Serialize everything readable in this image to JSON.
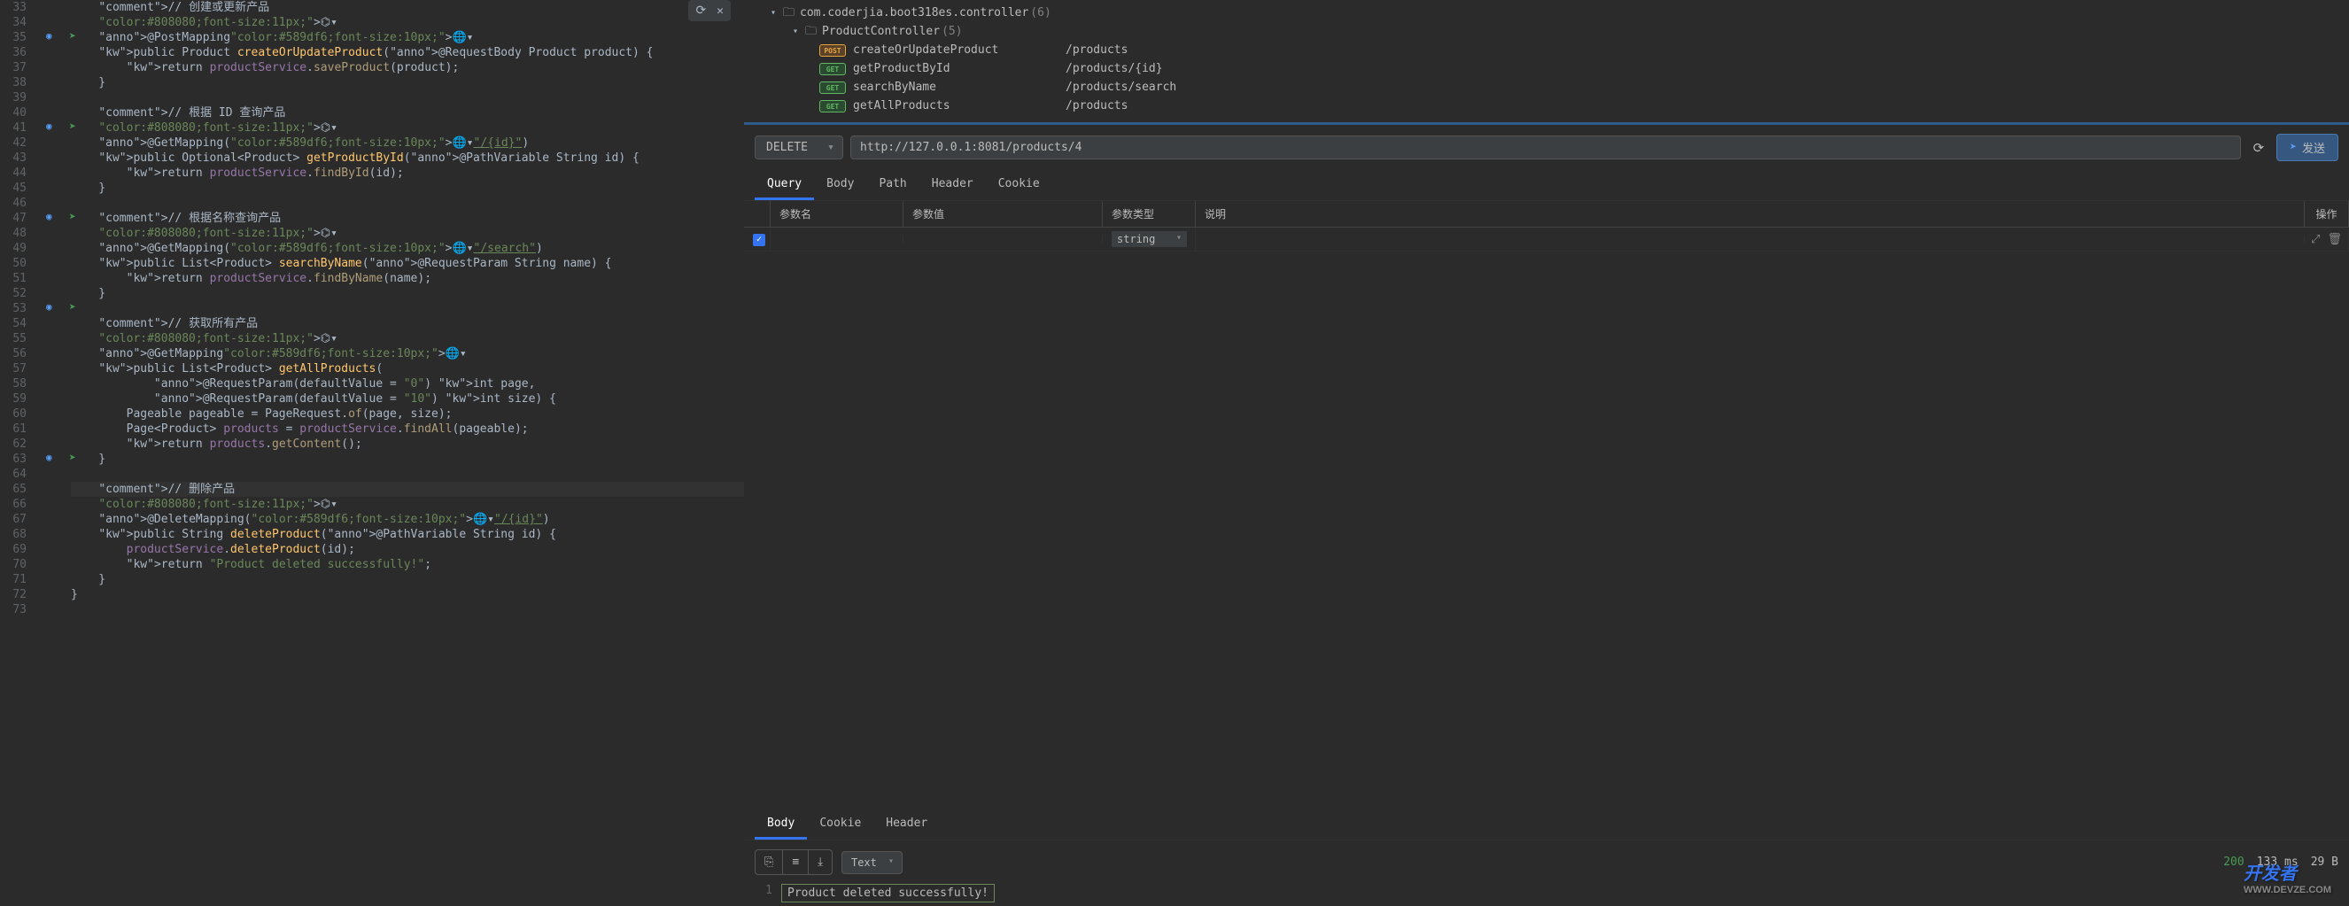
{
  "editor": {
    "firstLine": 33,
    "lines": [
      "    // 创建或更新产品",
      "    ⌬▾",
      "    @PostMapping🌐▾",
      "    public Product createOrUpdateProduct(@RequestBody Product product) {",
      "        return productService.saveProduct(product);",
      "    }",
      "",
      "    // 根据 ID 查询产品",
      "    ⌬▾",
      "    @GetMapping(🌐▾\"/{id}\")",
      "    public Optional<Product> getProductById(@PathVariable String id) {",
      "        return productService.findById(id);",
      "    }",
      "",
      "    // 根据名称查询产品",
      "    ⌬▾",
      "    @GetMapping(🌐▾\"/search\")",
      "    public List<Product> searchByName(@RequestParam String name) {",
      "        return productService.findByName(name);",
      "    }",
      "",
      "    // 获取所有产品",
      "    ⌬▾",
      "    @GetMapping🌐▾",
      "    public List<Product> getAllProducts(",
      "            @RequestParam(defaultValue = \"0\") int page,",
      "            @RequestParam(defaultValue = \"10\") int size) {",
      "        Pageable pageable = PageRequest.of(page, size);",
      "        Page<Product> products = productService.findAll(pageable);",
      "        return products.getContent();",
      "    }",
      "",
      "    // 删除产品",
      "    ⌬▾",
      "    @DeleteMapping(🌐▾\"/{id}\")",
      "    public String deleteProduct(@PathVariable String id) {",
      "        productService.deleteProduct(id);",
      "        return \"Product deleted successfully!\";",
      "    }",
      "}",
      ""
    ]
  },
  "tree": {
    "package": "com.coderjia.boot318es.controller",
    "packageCount": "(6)",
    "controller": "ProductController",
    "controllerCount": "(5)",
    "endpoints": [
      {
        "method": "POST",
        "name": "createOrUpdateProduct",
        "path": "/products"
      },
      {
        "method": "GET",
        "name": "getProductById",
        "path": "/products/{id}"
      },
      {
        "method": "GET",
        "name": "searchByName",
        "path": "/products/search"
      },
      {
        "method": "GET",
        "name": "getAllProducts",
        "path": "/products"
      }
    ]
  },
  "request": {
    "method": "DELETE",
    "url": "http://127.0.0.1:8081/products/4",
    "sendLabel": "发送"
  },
  "requestTabs": [
    "Query",
    "Body",
    "Path",
    "Header",
    "Cookie"
  ],
  "paramsHeader": {
    "name": "参数名",
    "value": "参数值",
    "type": "参数类型",
    "desc": "说明",
    "ops": "操作"
  },
  "paramsRows": [
    {
      "checked": true,
      "name": "",
      "value": "",
      "type": "string",
      "desc": ""
    }
  ],
  "responseTabs": [
    "Body",
    "Cookie",
    "Header"
  ],
  "response": {
    "format": "Text",
    "statusCode": "200",
    "time": "133 ms",
    "size": "29 B",
    "body": "Product deleted successfully!"
  },
  "watermark": {
    "main": "开发者",
    "sub": "WWW.DEVZE.COM"
  }
}
